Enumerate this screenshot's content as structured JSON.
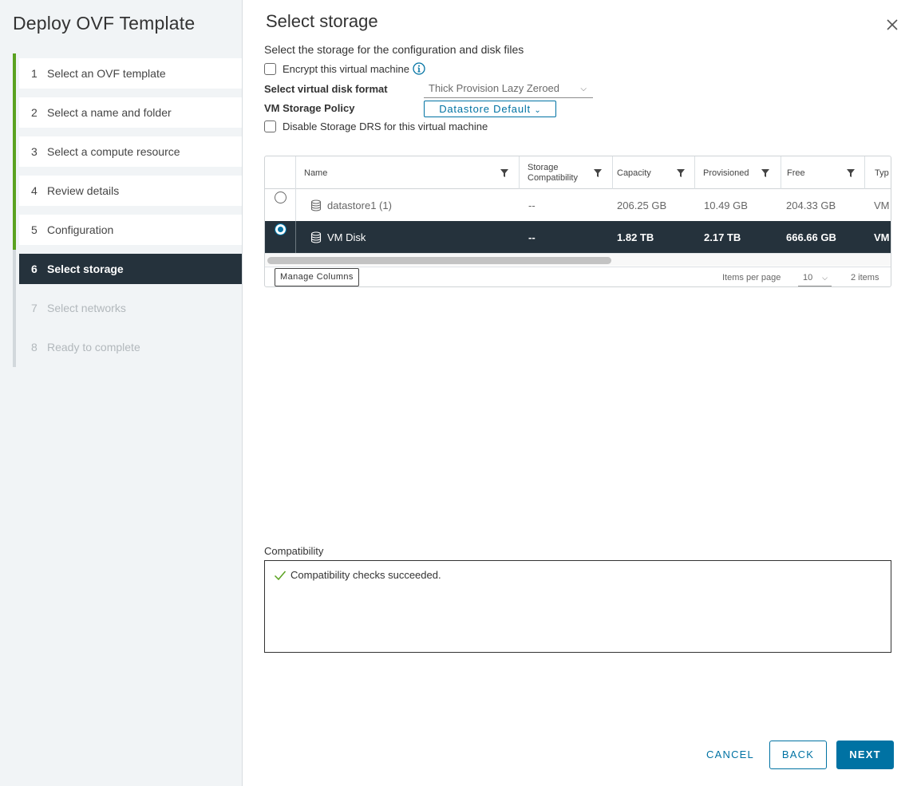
{
  "wizard": {
    "title": "Deploy OVF Template",
    "steps": [
      {
        "num": "1",
        "label": "Select an OVF template"
      },
      {
        "num": "2",
        "label": "Select a name and folder"
      },
      {
        "num": "3",
        "label": "Select a compute resource"
      },
      {
        "num": "4",
        "label": "Review details"
      },
      {
        "num": "5",
        "label": "Configuration"
      },
      {
        "num": "6",
        "label": "Select storage"
      },
      {
        "num": "7",
        "label": "Select networks"
      },
      {
        "num": "8",
        "label": "Ready to complete"
      }
    ],
    "active_step": 6
  },
  "page": {
    "title": "Select storage",
    "subtitle": "Select the storage for the configuration and disk files"
  },
  "options": {
    "encrypt_label": "Encrypt this virtual machine",
    "disk_format_label": "Select virtual disk format",
    "disk_format_value": "Thick Provision Lazy Zeroed",
    "policy_label": "VM Storage Policy",
    "policy_value": "Datastore Default",
    "disable_drs_label": "Disable Storage DRS for this virtual machine"
  },
  "grid": {
    "columns": [
      "Name",
      "Storage Compatibility",
      "Capacity",
      "Provisioned",
      "Free",
      "Typ"
    ],
    "storage_compat_line1": "Storage",
    "storage_compat_line2": "Compatibility",
    "rows": [
      {
        "name": "datastore1 (1)",
        "compat": "--",
        "capacity": "206.25 GB",
        "provisioned": "10.49 GB",
        "free": "204.33 GB",
        "type": "VM",
        "selected": false
      },
      {
        "name": "VM Disk",
        "compat": "--",
        "capacity": "1.82 TB",
        "provisioned": "2.17 TB",
        "free": "666.66 GB",
        "type": "VM",
        "selected": true
      }
    ],
    "manage_columns": "Manage Columns",
    "items_per_page_label": "Items per page",
    "items_per_page_value": "10",
    "item_count": "2 items"
  },
  "compatibility": {
    "label": "Compatibility",
    "message": "Compatibility checks succeeded."
  },
  "buttons": {
    "cancel": "CANCEL",
    "back": "BACK",
    "next": "NEXT"
  },
  "colors": {
    "accent": "#0072a3",
    "selected_row": "#25323c",
    "done_rail": "#5aa220",
    "success": "#5aa220"
  },
  "icons": [
    "close-icon",
    "info-icon",
    "filter-icon",
    "database-icon",
    "check-icon",
    "chevron-down-icon"
  ]
}
